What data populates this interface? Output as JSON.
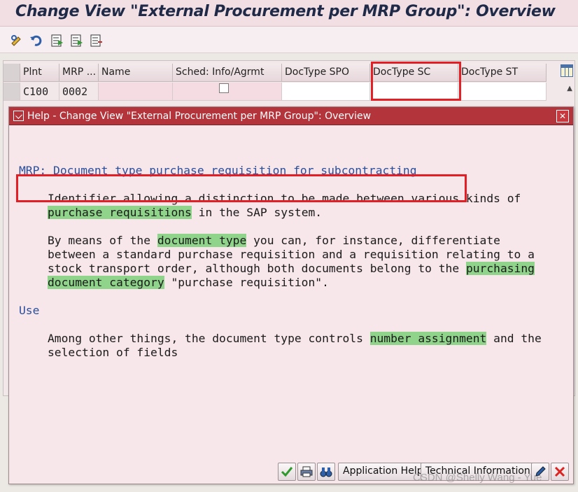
{
  "title_bar": {
    "title": "Change View \"External Procurement per MRP Group\": Overview"
  },
  "toolbar": {
    "icons": [
      "display-change-icon",
      "undo-icon",
      "select-all-icon",
      "select-block-icon",
      "deselect-all-icon"
    ]
  },
  "table": {
    "columns": [
      "Plnt",
      "MRP ...",
      "Name",
      "Sched: Info/Agrmt",
      "DocType SPO",
      "DocType SC",
      "DocType ST"
    ],
    "rows": [
      {
        "plnt": "C100",
        "mrp": "0002",
        "name": "",
        "sched_checked": false,
        "doctype_spo": "",
        "doctype_sc": "",
        "doctype_st": ""
      }
    ]
  },
  "dialog": {
    "title": "Help - Change View \"External Procurement per MRP Group\": Overview",
    "heading": "MRP: Document type purchase requisition for subcontracting",
    "p1_l1": "Identifier allowing a distinction to be made between various kinds of",
    "p1_l2_hl": "purchase requisitions",
    "p1_l2_rest": " in the SAP system.",
    "p2_l1_pre": "By means of the ",
    "p2_l1_hl": "document type",
    "p2_l1_post": " you can, for instance, differentiate",
    "p2_l2": "between a standard purchase requisition and a requisition relating to a",
    "p2_l3_pre": "stock transport order, although both documents belong to the ",
    "p2_l3_hl": "purchasing",
    "p2_l4_hl": "document category",
    "p2_l4_post": " \"purchase requisition\".",
    "use_heading": "Use",
    "p3_l1_pre": "Among other things, the document type controls ",
    "p3_l1_hl": "number assignment",
    "p3_l1_post": " and the",
    "p3_l2": "selection of fields",
    "buttons": {
      "application_help": "Application Help",
      "technical_information": "Technical Information"
    }
  },
  "watermark": "CSDN @Shelly Wang - Yue",
  "colors": {
    "accent_red": "#e31e25",
    "highlight": "#8fd48a",
    "title_text": "#1e2a48",
    "dialog_header": "#b3343b"
  }
}
